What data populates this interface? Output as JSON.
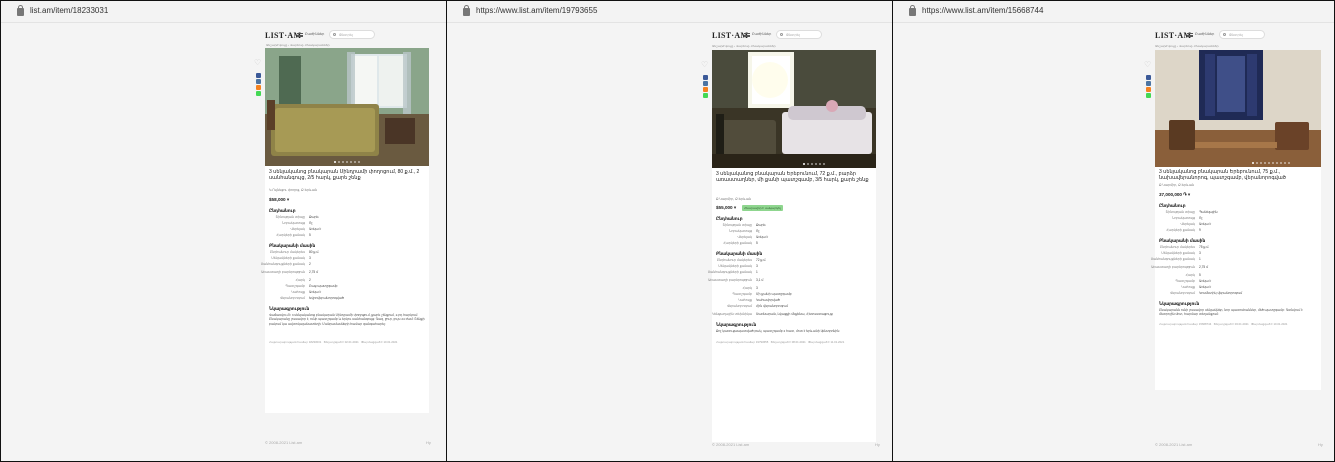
{
  "panels": [
    {
      "url": "list.am/item/18233031",
      "logo": "LIST·AM",
      "menu_label": "Բաժիններ",
      "search_placeholder": "Փնտրել",
      "breadcrumb": "Անշարժ գույք › Վարձով › Բնակարաններ",
      "title": "3 սենյականոց բնակարան Սինդրամի փողոցում, 80 ք.մ., 2 սանհանգույց, 2/5 հարկ, քարե շենք",
      "location": "Կ.Ուլնեցու փողոց, Ք.Երևան",
      "price": "$58,000 ▾",
      "sections": {
        "general": "Ընդհանուր",
        "apartment": "Բնակարանի մասին",
        "description": "Նկարագրություն"
      },
      "general_rows": [
        {
          "k": "Շինության տիպը",
          "v": "Քարե"
        },
        {
          "k": "Նորակառույց",
          "v": "Ոչ"
        },
        {
          "k": "Վերելակ",
          "v": "Առկա է"
        },
        {
          "k": "Հարկերի քանակ",
          "v": "5"
        }
      ],
      "apartment_rows": [
        {
          "k": "Ընդհանուր մակերես",
          "v": "80 ք.մ."
        },
        {
          "k": "Սենյակների քանակ",
          "v": "3"
        },
        {
          "k": "Սանհանգույցների քանակ",
          "v": "2"
        },
        {
          "k": "Առաստաղի բարձրություն",
          "v": "2,75 մ"
        },
        {
          "k": "Հարկ",
          "v": "2"
        },
        {
          "k": "Պատշգամբ",
          "v": "Բաց պատշգամբ"
        },
        {
          "k": "Կահույք",
          "v": "Առկա է"
        },
        {
          "k": "Վերանորոգում",
          "v": "Եվրովերանորոգված"
        }
      ],
      "description": "Վաճառվում է 3 սենյականոց բնակարան Սինդրամի փողոցում, քարե շենքում, 2-րդ հարկում: Բնակարանը լուսավոր է, ունի պատշգամբ և երկու սանհանգույց: Գազ, ջուր, լույս 24 ժամ: Շենքի բակում կա ավտոկայանատեղի: Մանրամասների համար զանգահարել:",
      "meta": [
        "Հայտարարության համար 18233031",
        "Տեղադրված է 02.01.2021",
        "Թարմացված է 10.01.2021"
      ],
      "footer": "© 2008-2021 List.am",
      "footer_right": "Hy",
      "photo_dots": 7
    },
    {
      "url": "https://www.list.am/item/19793655",
      "logo": "LIST·AM",
      "menu_label": "Բաժիններ",
      "search_placeholder": "Փնտրել",
      "breadcrumb": "Անշարժ գույք › Վարձով › Բնակարաններ",
      "title": "3 սենյականոց բնակարան Երեբունում, 72 ք.մ., բարձր առաստաղներ, մի քանի պատշգամբ, 3/5 հարկ, քարե շենք",
      "location": "Ք.Կարմիր, Ք.Երևան",
      "price": "$55,000 ▾",
      "badge": "Հնարավոր է սակարկել",
      "sections": {
        "general": "Ընդհանուր",
        "apartment": "Բնակարանի մասին",
        "description": "Նկարագրություն"
      },
      "general_rows": [
        {
          "k": "Շինության տիպը",
          "v": "Քարե"
        },
        {
          "k": "Նորակառույց",
          "v": "Ոչ"
        },
        {
          "k": "Վերելակ",
          "v": "Առկա է"
        },
        {
          "k": "Հարկերի քանակ",
          "v": "5"
        }
      ],
      "apartment_rows": [
        {
          "k": "Ընդհանուր մակերես",
          "v": "72 ք.մ."
        },
        {
          "k": "Սենյակների քանակ",
          "v": "3"
        },
        {
          "k": "Սանհանգույցների քանակ",
          "v": "1"
        },
        {
          "k": "Առաստաղի բարձրություն",
          "v": "3,1 մ"
        },
        {
          "k": "Հարկ",
          "v": "3"
        },
        {
          "k": "Պատշգամբ",
          "v": "Մի քանի պատշգամբ"
        },
        {
          "k": "Կահույք",
          "v": "Կահավորված"
        },
        {
          "k": "Վերանորոգում",
          "v": "Հին վերանորոգում"
        },
        {
          "k": "Կենցաղային տեխնիկա",
          "v": "Սառնարան, Լվացքի մեքենա, Հեռուստացույց"
        }
      ],
      "description": "Քոչ կառուցապատված բակ, պատշգամբ 2 հատ, մոտ է Երևանի կենտրոնին:",
      "meta": [
        "Հայտարարության համար 19793655",
        "Տեղադրված է 08.01.2021",
        "Թարմացված է 11.01.2021"
      ],
      "footer": "© 2008-2021 List.am",
      "footer_right": "Hy",
      "photo_dots": 6
    },
    {
      "url": "https://www.list.am/item/15668744",
      "logo": "LIST·AM",
      "menu_label": "Բաժիններ",
      "search_placeholder": "Փնտրել",
      "breadcrumb": "Անշարժ գույք › Վարձով › Բնակարաններ",
      "title": "3 սենյականոց բնակարան Երեբունում, 75 ք.մ., նախավերանորոգ, պատշգամբ, վերանորոգված",
      "location": "Ք.Կարմիր, Ք.Երևան",
      "price": "37,000,000 ֏ ▾",
      "sections": {
        "general": "Ընդհանուր",
        "apartment": "Բնակարանի մասին",
        "description": "Նկարագրություն"
      },
      "general_rows": [
        {
          "k": "Շինության տիպը",
          "v": "Պանելային"
        },
        {
          "k": "Նորակառույց",
          "v": "Ոչ"
        },
        {
          "k": "Վերելակ",
          "v": "Առկա է"
        },
        {
          "k": "Հարկերի քանակ",
          "v": "9"
        }
      ],
      "apartment_rows": [
        {
          "k": "Ընդհանուր մակերես",
          "v": "75 ք.մ."
        },
        {
          "k": "Սենյակների քանակ",
          "v": "3"
        },
        {
          "k": "Սանհանգույցների քանակ",
          "v": "1"
        },
        {
          "k": "Առաստաղի բարձրություն",
          "v": "2,75 մ"
        },
        {
          "k": "Հարկ",
          "v": "5"
        },
        {
          "k": "Պատշգամբ",
          "v": "Առկա է"
        },
        {
          "k": "Կահույք",
          "v": "Առկա է"
        },
        {
          "k": "Վերանորոգում",
          "v": "Կոսմետիկ վերանորոգում"
        }
      ],
      "description": "Բնակարանն ունի լուսավոր սենյակներ, նոր պատուհաններ, մեծ պատշգամբ: Գտնվում է մետրոյին մոտ, հարմար տեղանքում:",
      "meta": [
        "Հայտարարության համար 15668744",
        "Տեղադրված է 03.01.2021",
        "Թարմացված է 10.01.2021"
      ],
      "footer": "© 2008-2021 List.am",
      "footer_right": "Hy",
      "photo_dots": 10
    }
  ],
  "colors": {
    "share_facebook": "#3b5998",
    "share_vk": "#4c75a3",
    "share_ok": "#f58220",
    "share_whatsapp": "#43d854",
    "badge": "#8fd68f"
  }
}
